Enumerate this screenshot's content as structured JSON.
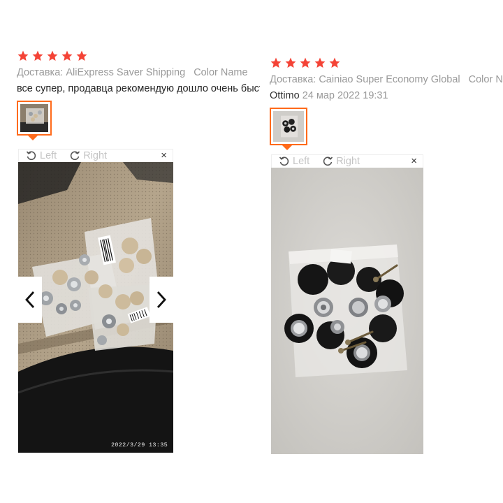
{
  "colors": {
    "star": "#f44336",
    "accent": "#ff6a1a",
    "meta_text": "#999999",
    "seat_leather": "#a8947a",
    "photo_bg_2": "#d2d0cc"
  },
  "reviews": [
    {
      "rating": 5,
      "shipping": "Доставка: AliExpress Saver Shipping",
      "color_label": "Color Name",
      "text": "все супер, продавца рекомендую дошло очень быстро",
      "viewer": {
        "rotate_left": "Left",
        "rotate_right": "Right",
        "close": "×",
        "prev_icon": "chevron-left-icon",
        "next_icon": "chevron-right-icon",
        "photo_timestamp": "2022/3/29  13:35"
      }
    },
    {
      "rating": 5,
      "shipping": "Доставка: Cainiao Super Economy Global",
      "color_label": "Color Name",
      "author": "Ottimo",
      "date": "24 мар 2022 19:31",
      "viewer": {
        "rotate_left": "Left",
        "rotate_right": "Right",
        "close": "×"
      }
    }
  ]
}
